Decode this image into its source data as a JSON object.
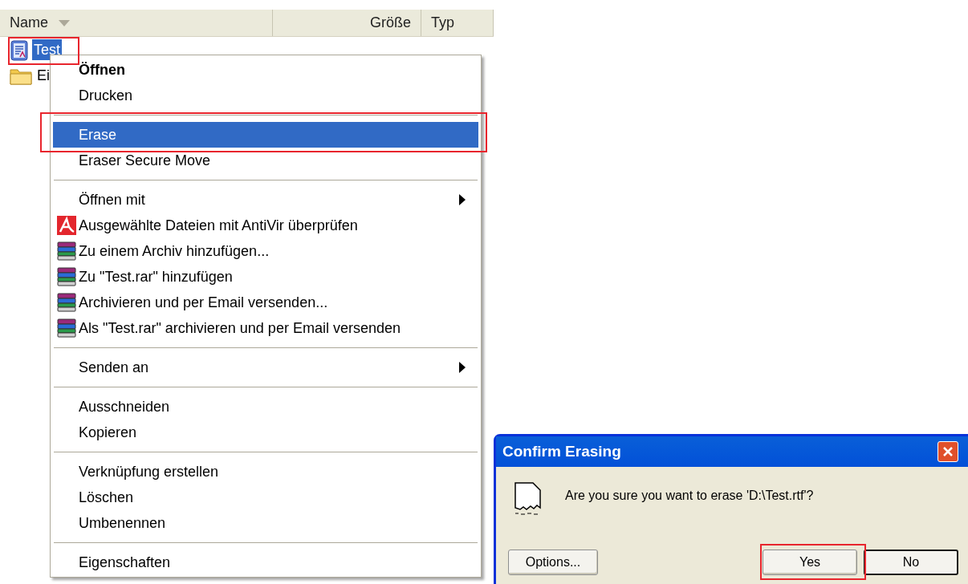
{
  "explorer": {
    "columns": [
      {
        "label": "Name",
        "sorted": true
      },
      {
        "label": "Größe",
        "sorted": false
      },
      {
        "label": "Typ",
        "sorted": false
      }
    ],
    "rows": [
      {
        "kind": "document",
        "name": "Test",
        "selected": true
      },
      {
        "kind": "folder",
        "name": "Ei",
        "selected": false
      }
    ]
  },
  "context_menu": {
    "items": [
      {
        "kind": "plain",
        "label": "Öffnen",
        "bold": true,
        "selected": false,
        "submenu": false
      },
      {
        "kind": "plain",
        "label": "Drucken",
        "bold": false,
        "selected": false,
        "submenu": false
      },
      {
        "kind": "separator"
      },
      {
        "kind": "plain",
        "label": "Erase",
        "bold": false,
        "selected": true,
        "submenu": false
      },
      {
        "kind": "plain",
        "label": "Eraser Secure Move",
        "bold": false,
        "selected": false,
        "submenu": false
      },
      {
        "kind": "separator"
      },
      {
        "kind": "plain",
        "label": "Öffnen mit",
        "bold": false,
        "selected": false,
        "submenu": true
      },
      {
        "kind": "antivirus",
        "label": "Ausgewählte Dateien mit AntiVir überprüfen",
        "bold": false,
        "selected": false,
        "submenu": false
      },
      {
        "kind": "archive",
        "label": "Zu einem Archiv hinzufügen...",
        "bold": false,
        "selected": false,
        "submenu": false
      },
      {
        "kind": "archive",
        "label": "Zu \"Test.rar\" hinzufügen",
        "bold": false,
        "selected": false,
        "submenu": false
      },
      {
        "kind": "archive",
        "label": "Archivieren und per Email versenden...",
        "bold": false,
        "selected": false,
        "submenu": false
      },
      {
        "kind": "archive",
        "label": "Als \"Test.rar\" archivieren und per Email versenden",
        "bold": false,
        "selected": false,
        "submenu": false
      },
      {
        "kind": "separator"
      },
      {
        "kind": "plain",
        "label": "Senden an",
        "bold": false,
        "selected": false,
        "submenu": true
      },
      {
        "kind": "separator"
      },
      {
        "kind": "plain",
        "label": "Ausschneiden",
        "bold": false,
        "selected": false,
        "submenu": false
      },
      {
        "kind": "plain",
        "label": "Kopieren",
        "bold": false,
        "selected": false,
        "submenu": false
      },
      {
        "kind": "separator"
      },
      {
        "kind": "plain",
        "label": "Verknüpfung erstellen",
        "bold": false,
        "selected": false,
        "submenu": false
      },
      {
        "kind": "plain",
        "label": "Löschen",
        "bold": false,
        "selected": false,
        "submenu": false
      },
      {
        "kind": "plain",
        "label": "Umbenennen",
        "bold": false,
        "selected": false,
        "submenu": false
      },
      {
        "kind": "separator"
      },
      {
        "kind": "plain",
        "label": "Eigenschaften",
        "bold": false,
        "selected": false,
        "submenu": false
      }
    ]
  },
  "dialog": {
    "title": "Confirm Erasing",
    "message": "Are you sure you want to erase 'D:\\Test.rtf'?",
    "buttons": [
      {
        "label": "Options...",
        "default": false
      },
      {
        "label": "Yes",
        "default": false
      },
      {
        "label": "No",
        "default": true
      }
    ]
  }
}
